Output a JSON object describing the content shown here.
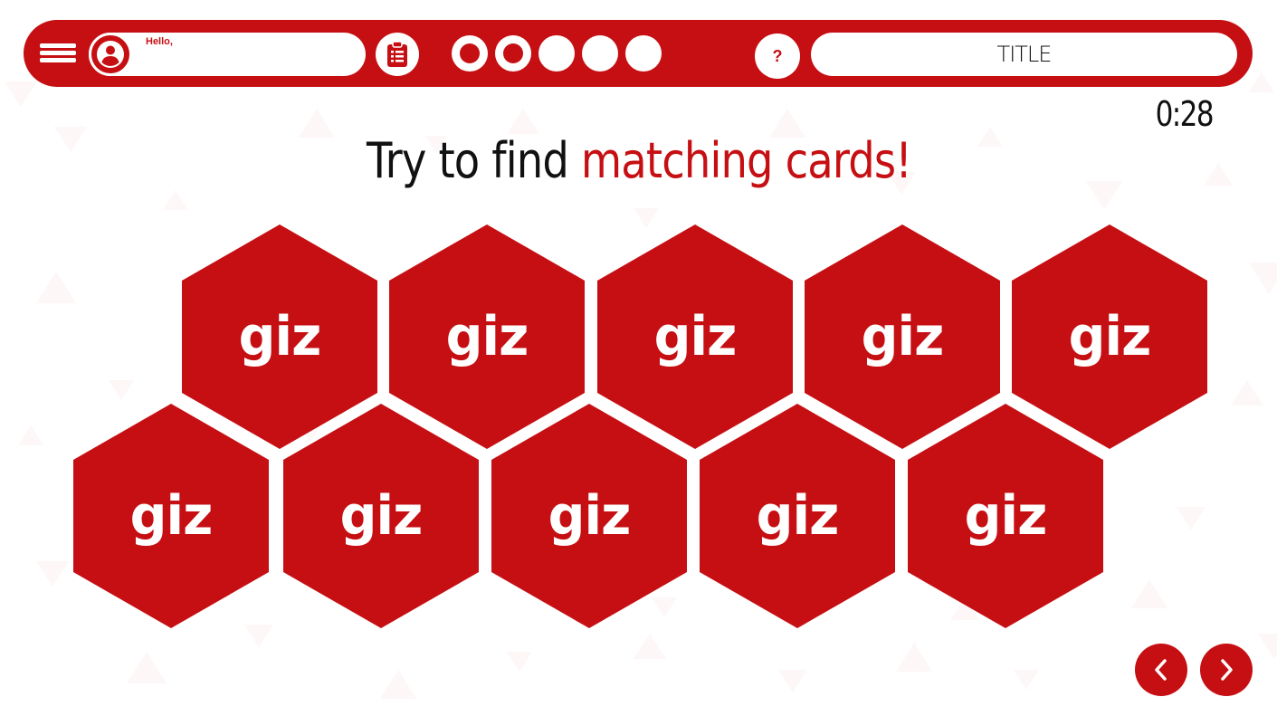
{
  "theme": {
    "accent": "#c60f13",
    "text": "#111111",
    "background": "#ffffff"
  },
  "header": {
    "menu_icon": "hamburger-menu-icon",
    "user_icon": "user-avatar-icon",
    "greeting": "Hello,",
    "clipboard_icon": "clipboard-list-icon",
    "progress": [
      "done",
      "done",
      "pending",
      "pending",
      "pending"
    ],
    "help_label": "?",
    "title": "TITLE"
  },
  "timer": "0:28",
  "instructions": {
    "prefix": "Try to find ",
    "highlight": "matching cards!"
  },
  "cards": [
    {
      "label": "giz",
      "state": "face-down"
    },
    {
      "label": "giz",
      "state": "face-down"
    },
    {
      "label": "giz",
      "state": "face-down"
    },
    {
      "label": "giz",
      "state": "face-down"
    },
    {
      "label": "giz",
      "state": "face-down"
    },
    {
      "label": "giz",
      "state": "face-down"
    },
    {
      "label": "giz",
      "state": "face-down"
    },
    {
      "label": "giz",
      "state": "face-down"
    },
    {
      "label": "giz",
      "state": "face-down"
    },
    {
      "label": "giz",
      "state": "face-down"
    }
  ],
  "navigation": {
    "prev_icon": "chevron-left-icon",
    "next_icon": "chevron-right-icon"
  }
}
